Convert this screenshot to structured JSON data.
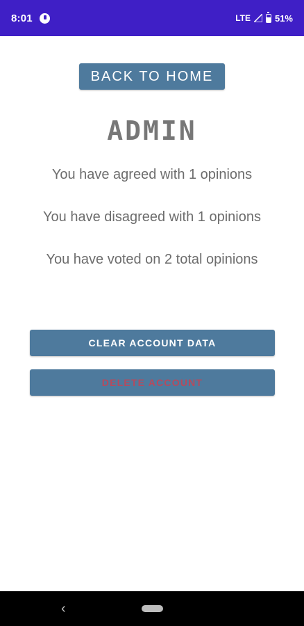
{
  "status_bar": {
    "time": "8:01",
    "network": "LTE",
    "battery": "51%",
    "icons": [
      "notification-icon",
      "signal-icon",
      "battery-icon"
    ]
  },
  "header": {
    "back_button_label": "BACK TO HOME",
    "title": "ADMIN"
  },
  "stats": {
    "agreed": "You have agreed with 1 opinions",
    "disagreed": "You have disagreed with 1 opinions",
    "total": "You have voted on 2 total opinions"
  },
  "actions": {
    "clear_label": "CLEAR ACCOUNT DATA",
    "delete_label": "DELETE ACCOUNT"
  },
  "colors": {
    "status_bar": "#3f1fc6",
    "button_bg": "#4e7a9d",
    "delete_text": "#b64a5d",
    "title_text": "#777777",
    "body_text": "#6d6d6d"
  }
}
